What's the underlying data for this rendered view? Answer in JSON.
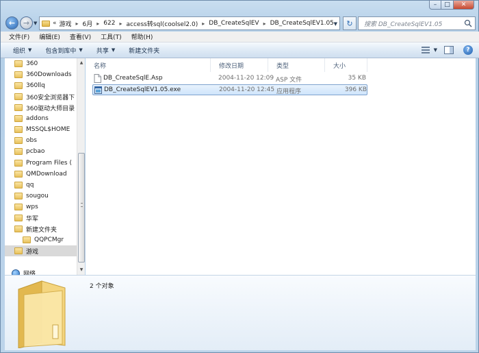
{
  "window": {
    "caption": {
      "minimize": "–",
      "maximize": "□",
      "close": "✕"
    }
  },
  "address": {
    "prefix": "«",
    "crumbs": [
      "游戏",
      "6月",
      "622",
      "access转sql(coolsel2.0)",
      "DB_CreateSqlEV",
      "DB_CreateSqlEV1.05"
    ]
  },
  "search": {
    "placeholder": "搜索 DB_CreateSqlEV1.05"
  },
  "menu": [
    "文件(F)",
    "编辑(E)",
    "查看(V)",
    "工具(T)",
    "帮助(H)"
  ],
  "toolbar": {
    "organize": "组织",
    "include_in_library": "包含到库中",
    "share": "共享",
    "new_folder": "新建文件夹"
  },
  "navpane": {
    "items": [
      {
        "label": "360"
      },
      {
        "label": "360Downloads"
      },
      {
        "label": "360llq"
      },
      {
        "label": "360安全浏览器下"
      },
      {
        "label": "360驱动大师目录"
      },
      {
        "label": "addons"
      },
      {
        "label": "MSSQL$HOME"
      },
      {
        "label": "obs"
      },
      {
        "label": "pcbao"
      },
      {
        "label": "Program Files ("
      },
      {
        "label": "QMDownload"
      },
      {
        "label": "qq"
      },
      {
        "label": "sougou"
      },
      {
        "label": "wps"
      },
      {
        "label": "华军"
      },
      {
        "label": "新建文件夹"
      },
      {
        "label": "QQPCMgr"
      },
      {
        "label": "游戏"
      }
    ],
    "network": "网络"
  },
  "columns": {
    "name": "名称",
    "date": "修改日期",
    "type": "类型",
    "size": "大小"
  },
  "files": [
    {
      "name": "DB_CreateSqlE.Asp",
      "date": "2004-11-20 12:09",
      "type": "ASP 文件",
      "size": "35 KB",
      "icon": "document-icon"
    },
    {
      "name": "DB_CreateSqlEV1.05.exe",
      "date": "2004-11-20 12:45",
      "type": "应用程序",
      "size": "396 KB",
      "icon": "application-icon"
    }
  ],
  "details": {
    "count": "2 个对象"
  },
  "colors": {
    "accent": "#2867b6",
    "selection": "#cfe5fb",
    "folder": "#e8c25d"
  }
}
